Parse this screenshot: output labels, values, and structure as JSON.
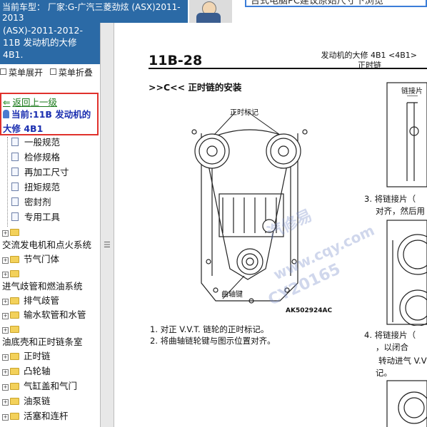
{
  "header": {
    "car_model_label": "当前车型：",
    "car_model_value": "厂家:G-广汽三菱劲炫 (ASX)2011-2013",
    "banner_text": "台式电脑PC建议原始尺寸下浏览"
  },
  "sidebar": {
    "model_text": "(ASX)-2011-2012- 11B 发动机的大修 4B1.",
    "menu_expand": "菜单展开",
    "menu_collapse": "菜单折叠",
    "back_link": "返回上一级",
    "current_prefix": "当前:11B 发动机的",
    "current_suffix": "大修 4B1",
    "doc_items": [
      "一般规范",
      "检修规格",
      "再加工尺寸",
      "扭矩规范",
      "密封剂",
      "专用工具"
    ],
    "sections": [
      {
        "title": "交流发电机和点火系统",
        "folders": [
          "节气门体"
        ]
      },
      {
        "title": "进气歧管和燃油系统",
        "folders": [
          "排气歧管",
          "输水软管和水管"
        ]
      },
      {
        "title": "油底壳和正时链条室",
        "folders": [
          "正时链",
          "凸轮轴",
          "气缸盖和气门",
          "油泵链",
          "活塞和连杆"
        ]
      }
    ]
  },
  "document": {
    "page_number": "11B-28",
    "section_line1": "发动机的大修 4B1 <4B1>",
    "section_line2": "正时链",
    "section_heading": ">>C<< 正时链的安装",
    "label_timing_mark": "正时标记",
    "label_crank_key": "曲轴键",
    "figure_code": "AK502924AC",
    "step1": "1. 对正 V.V.T. 链轮的正时标记。",
    "step2": "2. 将曲轴链轮键与图示位置对齐。",
    "right_label_chain": "链接片",
    "right_step3a": "3. 将链接片（",
    "right_step3b": "对齐，然后用",
    "right_step4a": "4. 将链接片（",
    "right_step4b": "，以闭合",
    "right_step4c": "转动进气 V.V",
    "right_step4d": "记。",
    "watermark1": "汽修易",
    "watermark2": "www.cqy.com",
    "watermark3": "CY20165"
  }
}
